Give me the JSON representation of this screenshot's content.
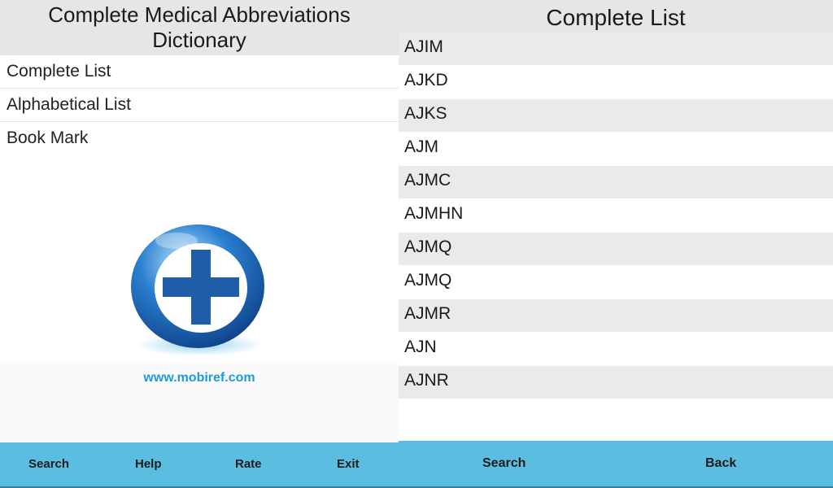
{
  "left": {
    "title_line1": "Complete Medical Abbreviations",
    "title_line2": "Dictionary",
    "menu": [
      {
        "label": "Complete List"
      },
      {
        "label": "Alphabetical List"
      },
      {
        "label": "Book Mark"
      }
    ],
    "logo_icon": "medical-cross-icon",
    "url": "www.mobiref.com",
    "toolbar": {
      "search": "Search",
      "help": "Help",
      "rate": "Rate",
      "exit": "Exit"
    }
  },
  "right": {
    "title": "Complete List",
    "items": [
      "AJIM",
      "AJKD",
      "AJKS",
      "AJM",
      "AJMC",
      "AJMHN",
      "AJMQ",
      "AJMQ",
      "AJMR",
      "AJN",
      "AJNR"
    ],
    "toolbar": {
      "search": "Search",
      "back": "Back"
    }
  },
  "colors": {
    "accent_bar": "#5bbde0",
    "header_bg": "#e6e6e6",
    "row_alt": "#ece9e9",
    "link": "#1e9bd7",
    "logo_blue": "#1f5ea8"
  }
}
